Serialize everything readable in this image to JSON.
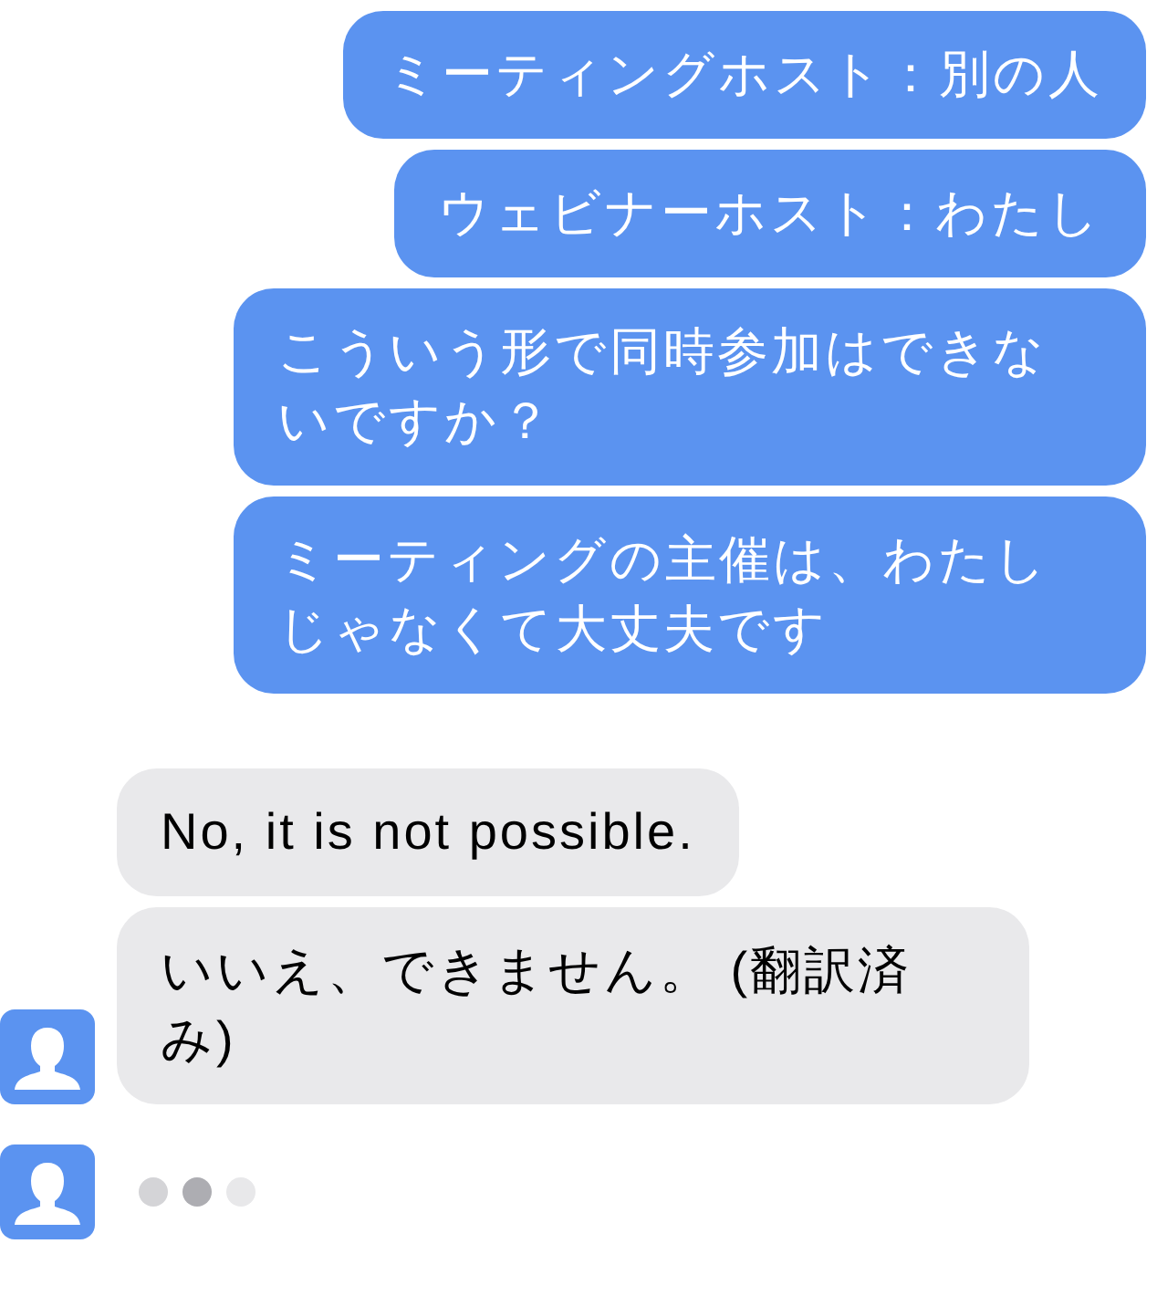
{
  "messages": [
    {
      "kind": "sent",
      "text": "ミーティングホスト：別の人"
    },
    {
      "kind": "sent",
      "text": "ウェビナーホスト：わたし"
    },
    {
      "kind": "sent",
      "text": "こういう形で同時参加はできないですか？"
    },
    {
      "kind": "sent",
      "text": "ミーティングの主催は、わたしじゃなくて大丈夫です"
    },
    {
      "kind": "received",
      "text": "No, it is not possible.",
      "avatar": false
    },
    {
      "kind": "received",
      "text": "いいえ、できません。 (翻訳済み)",
      "avatar": true
    }
  ],
  "typing": true
}
